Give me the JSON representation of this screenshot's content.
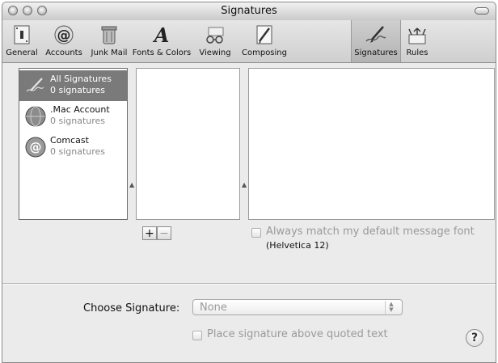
{
  "window": {
    "title": "Signatures"
  },
  "toolbar": {
    "items": [
      {
        "label": "General",
        "icon": "general-switch-icon"
      },
      {
        "label": "Accounts",
        "icon": "at-sign-icon"
      },
      {
        "label": "Junk Mail",
        "icon": "trash-can-icon"
      },
      {
        "label": "Fonts & Colors",
        "icon": "font-a-icon"
      },
      {
        "label": "Viewing",
        "icon": "glasses-icon"
      },
      {
        "label": "Composing",
        "icon": "pencil-paper-icon"
      },
      {
        "label": "Signatures",
        "icon": "pen-signature-icon"
      },
      {
        "label": "Rules",
        "icon": "rules-arrows-icon"
      }
    ],
    "selected": "Signatures"
  },
  "accounts": [
    {
      "name": "All Signatures",
      "count": "0 signatures",
      "icon": "signature-pen-icon",
      "selected": true
    },
    {
      "name": ".Mac Account",
      "count": "0 signatures",
      "icon": "mac-globe-icon",
      "selected": false
    },
    {
      "name": "Comcast",
      "count": "0 signatures",
      "icon": "at-sign-icon",
      "selected": false
    }
  ],
  "list_buttons": {
    "add": "+",
    "remove": "−"
  },
  "font_option": {
    "label": "Always match my default message font",
    "font_name": "(Helvetica 12)"
  },
  "choose_signature": {
    "label": "Choose Signature:",
    "value": "None"
  },
  "place_above": {
    "label": "Place signature above quoted text"
  },
  "help": {
    "label": "?"
  }
}
